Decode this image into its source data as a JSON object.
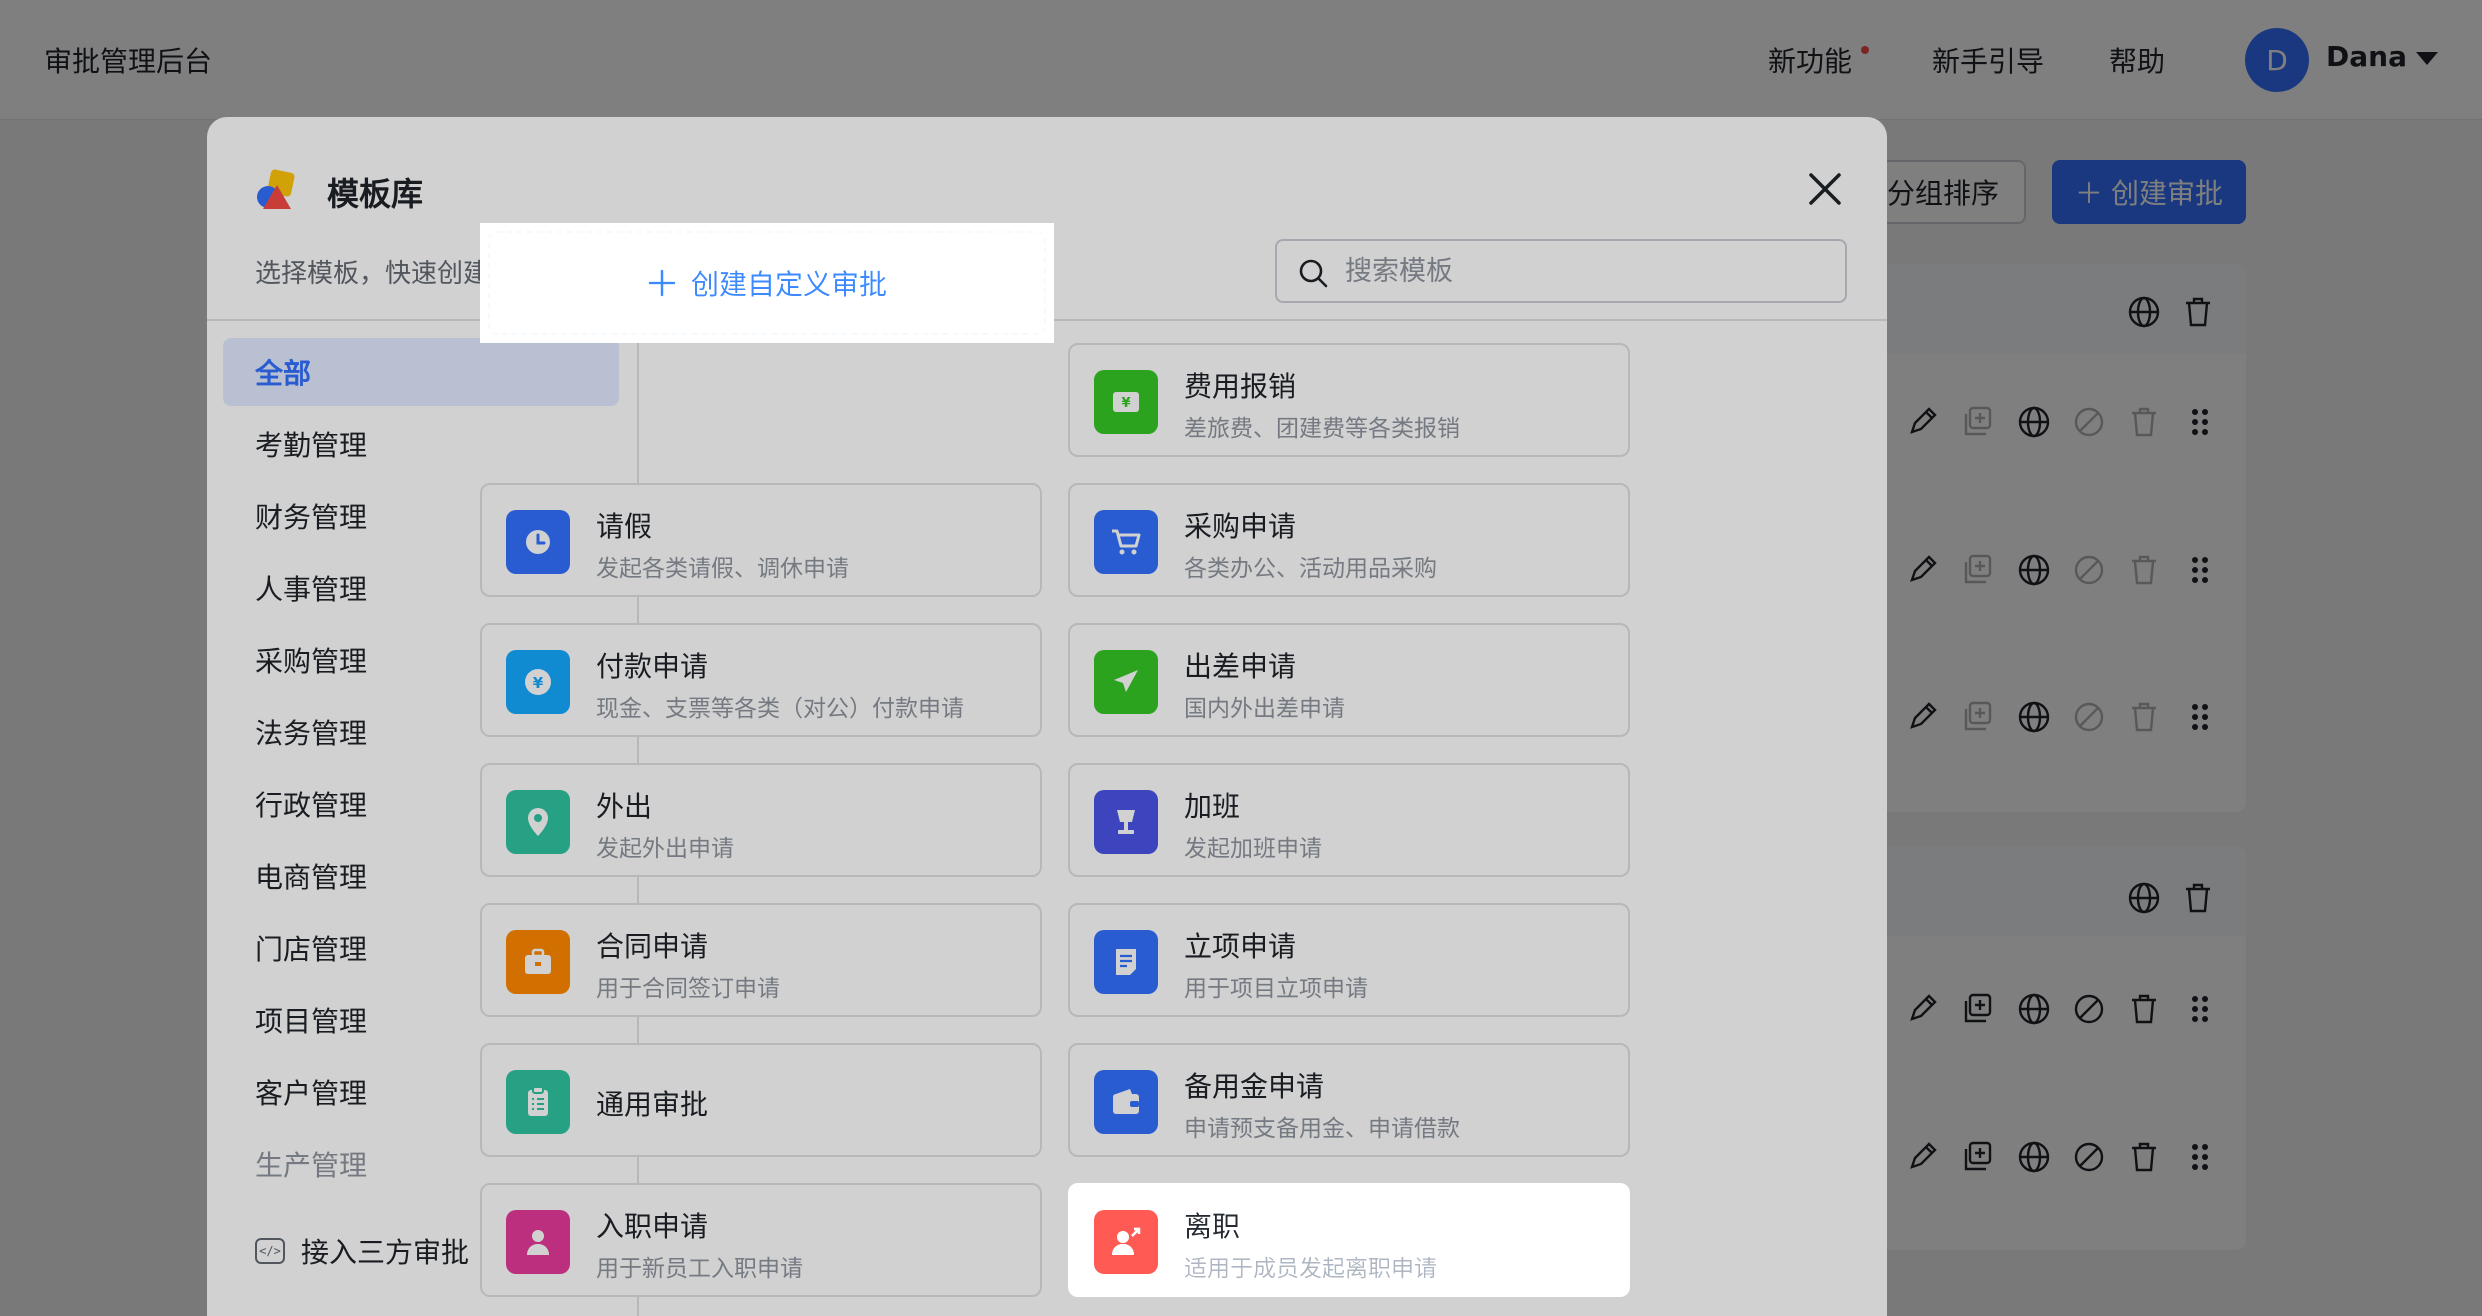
{
  "app": {
    "title": "审批管理后台",
    "nav": {
      "new_features": "新功能",
      "guide": "新手引导",
      "help": "帮助"
    },
    "user": {
      "initial": "D",
      "name": "Dana"
    },
    "buttons": {
      "sort_groups": "分组排序",
      "create_approval": "创建审批"
    }
  },
  "modal": {
    "title": "模板库",
    "subtitle": "选择模板，快速创建审批",
    "search_placeholder": "搜索模板",
    "categories": [
      "全部",
      "考勤管理",
      "财务管理",
      "人事管理",
      "采购管理",
      "法务管理",
      "行政管理",
      "电商管理",
      "门店管理",
      "项目管理",
      "客户管理",
      "生产管理"
    ],
    "active_category": "全部",
    "third_party": "接入三方审批",
    "custom_create": "创建自定义审批",
    "templates": [
      {
        "name": "费用报销",
        "desc": "差旅费、团建费等各类报销",
        "icon": "yen-bill-icon",
        "color": "#34c724"
      },
      {
        "name": "请假",
        "desc": "发起各类请假、调休申请",
        "icon": "clock-icon",
        "color": "#3370ff"
      },
      {
        "name": "采购申请",
        "desc": "各类办公、活动用品采购",
        "icon": "cart-icon",
        "color": "#3370ff"
      },
      {
        "name": "付款申请",
        "desc": "现金、支票等各类（对公）付款申请",
        "icon": "yen-coin-icon",
        "color": "#14a9ff"
      },
      {
        "name": "出差申请",
        "desc": "国内外出差申请",
        "icon": "airplane-icon",
        "color": "#34c724"
      },
      {
        "name": "外出",
        "desc": "发起外出申请",
        "icon": "location-icon",
        "color": "#2ec4a0"
      },
      {
        "name": "加班",
        "desc": "发起加班申请",
        "icon": "lamp-icon",
        "color": "#4954e6"
      },
      {
        "name": "合同申请",
        "desc": "用于合同签订申请",
        "icon": "briefcase-icon",
        "color": "#ff8800"
      },
      {
        "name": "立项申请",
        "desc": "用于项目立项申请",
        "icon": "document-icon",
        "color": "#3370ff"
      },
      {
        "name": "通用审批",
        "desc": "",
        "icon": "clipboard-icon",
        "color": "#2ec4a0"
      },
      {
        "name": "备用金申请",
        "desc": "申请预支备用金、申请借款",
        "icon": "wallet-icon",
        "color": "#3370ff"
      },
      {
        "name": "入职申请",
        "desc": "用于新员工入职申请",
        "icon": "person-icon",
        "color": "#e5399a"
      },
      {
        "name": "离职",
        "desc": "适用于成员发起离职申请",
        "icon": "person-leave-icon",
        "color": "#f54a45"
      }
    ]
  }
}
